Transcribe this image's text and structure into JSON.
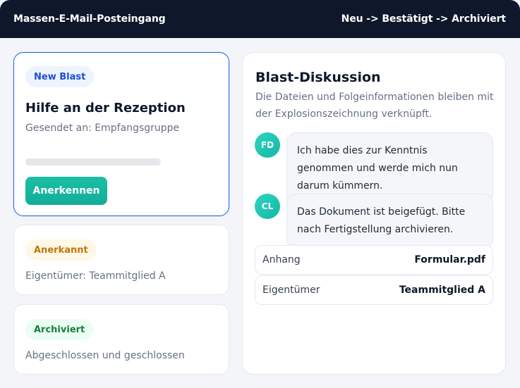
{
  "header": {
    "title": "Massen-E-Mail-Posteingang",
    "workflow": "Neu -> Bestätigt -> Archiviert"
  },
  "cards": [
    {
      "badge": "New Blast",
      "title": "Hilfe an der Rezeption",
      "subtitle": "Gesendet an: Empfangsgruppe",
      "progress": 0,
      "button": "Anerkennen"
    },
    {
      "badge": "Anerkannt",
      "subtitle": "Eigentümer: Teammitglied A"
    },
    {
      "badge": "Archiviert",
      "subtitle": "Abgeschlossen und geschlossen"
    }
  ],
  "discussion": {
    "title": "Blast-Diskussion",
    "description": "Die Dateien und Folgeinformationen bleiben mit der Explosionszeichnung verknüpft.",
    "messages": [
      {
        "initials": "FD",
        "text": "Ich habe dies zur Kenntnis genommen und werde mich nun darum kümmern."
      },
      {
        "initials": "CL",
        "text": "Das Dokument ist beigefügt. Bitte nach Fertigstellung archivieren."
      }
    ],
    "meta": [
      {
        "key": "Anhang",
        "value": "Formular.pdf"
      },
      {
        "key": "Eigentümer",
        "value": "Teammitglied A"
      }
    ]
  },
  "colors": {
    "header_bg": "#0f172a",
    "accent": "#14b8a6",
    "active_border": "#2563eb"
  }
}
